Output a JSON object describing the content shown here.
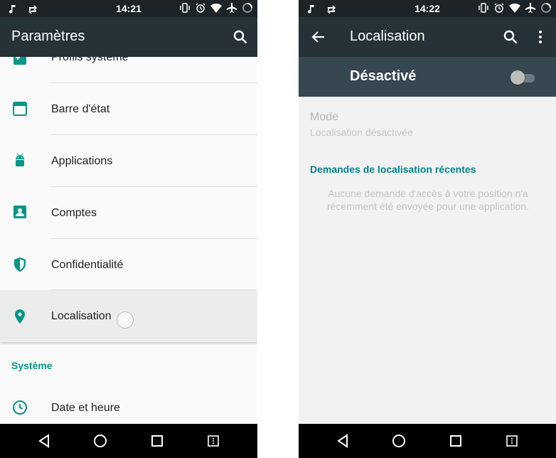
{
  "left": {
    "status": {
      "time": "14:21"
    },
    "toolbar": {
      "title": "Paramètres",
      "search_icon": "search-icon"
    },
    "items": [
      {
        "label": "Profils système",
        "icon": "profiles-icon"
      },
      {
        "label": "Barre d'état",
        "icon": "status-bar-icon"
      },
      {
        "label": "Applications",
        "icon": "android-icon"
      },
      {
        "label": "Comptes",
        "icon": "account-icon"
      },
      {
        "label": "Confidentialité",
        "icon": "shield-icon"
      },
      {
        "label": "Localisation",
        "icon": "location-pin-icon"
      }
    ],
    "section": "Système",
    "section_items": [
      {
        "label": "Date et heure",
        "icon": "clock-icon"
      }
    ]
  },
  "right": {
    "status": {
      "time": "14:22"
    },
    "toolbar": {
      "title": "Localisation",
      "back_icon": "back-arrow-icon",
      "search_icon": "search-icon",
      "menu_icon": "overflow-menu-icon"
    },
    "switch": {
      "label": "Désactivé",
      "on": false
    },
    "mode": {
      "title": "Mode",
      "subtitle": "Localisation désactivée"
    },
    "recent": {
      "heading": "Demandes de localisation récentes",
      "empty_line1": "Aucune demande d'accès à votre position n'a",
      "empty_line2": "récemment été envoyée pour une application."
    }
  },
  "colors": {
    "toolbar": "#263238",
    "switchbar": "#37474f",
    "accent": "#009688",
    "navbar": "#000000"
  }
}
